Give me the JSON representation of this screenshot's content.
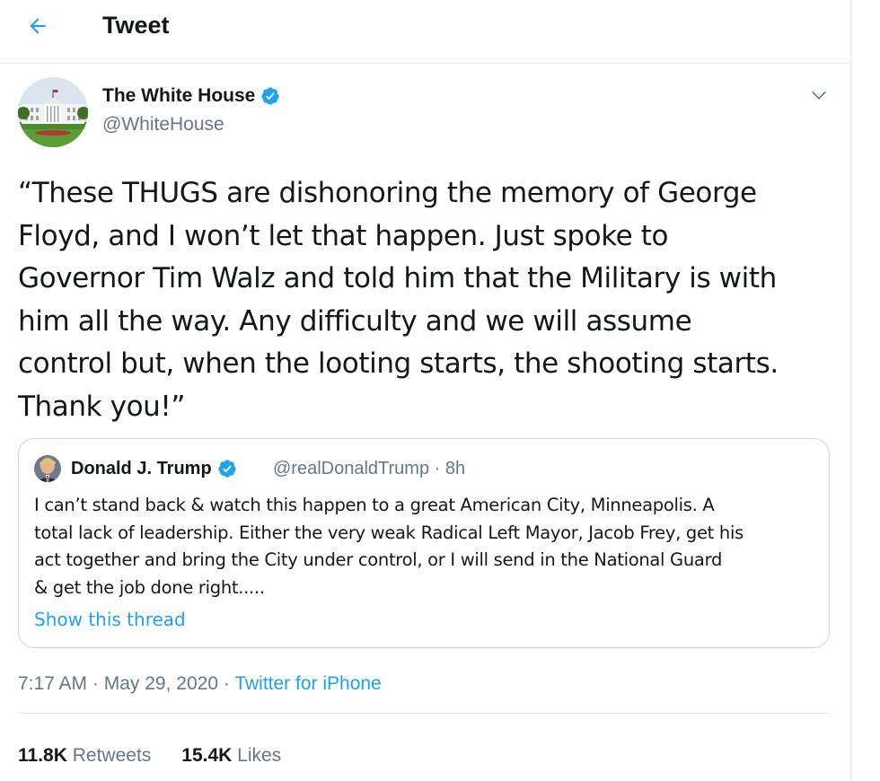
{
  "header": {
    "title": "Tweet",
    "back_icon": "arrow-left-icon",
    "accent": "#1da1f2"
  },
  "tweet": {
    "author_name": "The White House",
    "author_handle": "@WhiteHouse",
    "verified_icon": "verified-badge-icon",
    "caret_icon": "chevron-down-icon",
    "text_lines": [
      "“These THUGS are dishonoring the memory of George",
      "Floyd, and I won’t let that happen. Just spoke to",
      "Governor Tim Walz and told him that the Military is with",
      "him all the way. Any difficulty and we will assume",
      "control but, when the looting starts, the shooting starts.",
      "Thank you!”"
    ]
  },
  "quote": {
    "author_name": "Donald J. Trump",
    "author_handle": "@realDonaldTrump",
    "separator": "·",
    "age": "8h",
    "text_lines": [
      "I can’t stand back & watch this happen to a great American City, Minneapolis. A",
      "total lack of leadership. Either the very weak Radical Left Mayor, Jacob Frey, get his",
      "act together and bring the City under control, or I will send in the National Guard",
      "& get the job done right....."
    ],
    "show_thread_label": "Show this thread"
  },
  "meta": {
    "time": "7:17 AM",
    "separator": "·",
    "date": "May 29, 2020",
    "source": "Twitter for iPhone"
  },
  "stats": {
    "retweets_count": "11.8K",
    "retweets_label": "Retweets",
    "likes_count": "15.4K",
    "likes_label": "Likes"
  },
  "colors": {
    "text_primary": "#14171a",
    "text_secondary": "#657786",
    "link": "#1da1f2",
    "border": "#e6ecf0",
    "verified": "#1da1f2"
  }
}
